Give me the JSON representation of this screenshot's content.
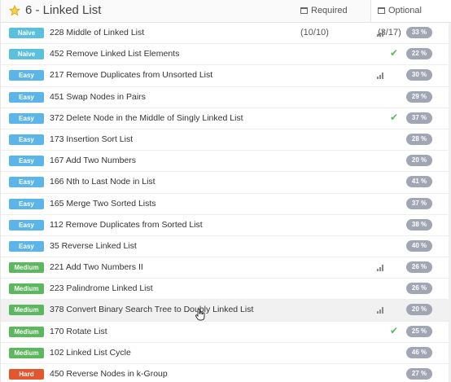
{
  "header": {
    "title": "6 - Linked List",
    "required_tab": "Required (10/10)",
    "optional_tab": "Optional (3/17)"
  },
  "problems": [
    {
      "level": "Naive",
      "name": "228 Middle of Linked List",
      "signal": true,
      "check": false,
      "pct": "33 %"
    },
    {
      "level": "Naive",
      "name": "452 Remove Linked List Elements",
      "signal": false,
      "check": true,
      "pct": "22 %"
    },
    {
      "level": "Easy",
      "name": "217 Remove Duplicates from Unsorted List",
      "signal": true,
      "check": false,
      "pct": "30 %"
    },
    {
      "level": "Easy",
      "name": "451 Swap Nodes in Pairs",
      "signal": false,
      "check": false,
      "pct": "29 %"
    },
    {
      "level": "Easy",
      "name": "372 Delete Node in the Middle of Singly Linked List",
      "signal": false,
      "check": true,
      "pct": "37 %"
    },
    {
      "level": "Easy",
      "name": "173 Insertion Sort List",
      "signal": false,
      "check": false,
      "pct": "28 %"
    },
    {
      "level": "Easy",
      "name": "167 Add Two Numbers",
      "signal": false,
      "check": false,
      "pct": "20 %"
    },
    {
      "level": "Easy",
      "name": "166 Nth to Last Node in List",
      "signal": false,
      "check": false,
      "pct": "41 %"
    },
    {
      "level": "Easy",
      "name": "165 Merge Two Sorted Lists",
      "signal": false,
      "check": false,
      "pct": "37 %"
    },
    {
      "level": "Easy",
      "name": "112 Remove Duplicates from Sorted List",
      "signal": false,
      "check": false,
      "pct": "38 %"
    },
    {
      "level": "Easy",
      "name": "35 Reverse Linked List",
      "signal": false,
      "check": false,
      "pct": "40 %"
    },
    {
      "level": "Medium",
      "name": "221 Add Two Numbers II",
      "signal": true,
      "check": false,
      "pct": "26 %"
    },
    {
      "level": "Medium",
      "name": "223 Palindrome Linked List",
      "signal": false,
      "check": false,
      "pct": "26 %"
    },
    {
      "level": "Medium",
      "name": "378 Convert Binary Search Tree to Doubly Linked List",
      "signal": true,
      "check": false,
      "pct": "20 %",
      "highlight": true
    },
    {
      "level": "Medium",
      "name": "170 Rotate List",
      "signal": false,
      "check": true,
      "pct": "25 %"
    },
    {
      "level": "Medium",
      "name": "102 Linked List Cycle",
      "signal": false,
      "check": false,
      "pct": "46 %"
    },
    {
      "level": "Hard",
      "name": "450 Reverse Nodes in k-Group",
      "signal": false,
      "check": false,
      "pct": "27 %"
    }
  ],
  "icons": {
    "header": "star-icon",
    "signal": "signal-bars-icon",
    "check": "check-icon",
    "tab": "list-icon"
  },
  "colors": {
    "naive": "#5bc0de",
    "easy": "#5bb5e8",
    "medium": "#5cb85c",
    "hard": "#e4572e",
    "pct_badge": "#a0a6b3",
    "check": "#5cb85c"
  }
}
